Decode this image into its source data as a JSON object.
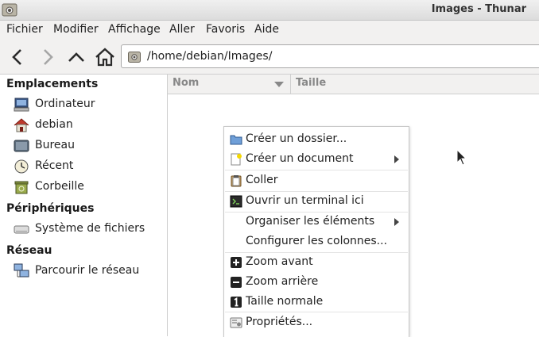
{
  "window": {
    "title": "Images - Thunar"
  },
  "menubar": {
    "items": [
      "Fichier",
      "Modifier",
      "Affichage",
      "Aller",
      "Favoris",
      "Aide"
    ]
  },
  "toolbar": {
    "icons": [
      "back-arrow-icon",
      "forward-arrow-icon",
      "parent-folder-icon",
      "home-icon"
    ],
    "location": "/home/debian/Images/"
  },
  "sidebar": {
    "sections": [
      {
        "title": "Emplacements",
        "items": [
          {
            "label": "Ordinateur",
            "icon": "computer-icon"
          },
          {
            "label": "debian",
            "icon": "home-folder-icon"
          },
          {
            "label": "Bureau",
            "icon": "desktop-icon"
          },
          {
            "label": "Récent",
            "icon": "clock-icon"
          },
          {
            "label": "Corbeille",
            "icon": "trash-icon"
          }
        ]
      },
      {
        "title": "Périphériques",
        "items": [
          {
            "label": "Système de fichiers",
            "icon": "drive-icon"
          }
        ]
      },
      {
        "title": "Réseau",
        "items": [
          {
            "label": "Parcourir le réseau",
            "icon": "network-icon"
          }
        ]
      }
    ]
  },
  "columns": [
    "Nom",
    "Taille"
  ],
  "context_menu": {
    "items": [
      {
        "label": "Créer un dossier...",
        "icon": "new-folder-icon"
      },
      {
        "label": "Créer un document",
        "icon": "new-document-icon",
        "submenu": true
      },
      {
        "label": "Coller",
        "icon": "paste-icon"
      },
      {
        "label": "Ouvrir un terminal ici",
        "icon": "terminal-icon"
      },
      {
        "label": "Organiser les éléments",
        "submenu": true
      },
      {
        "label": "Configurer les colonnes..."
      },
      {
        "label": "Zoom avant",
        "icon": "zoom-in-icon"
      },
      {
        "label": "Zoom arrière",
        "icon": "zoom-out-icon"
      },
      {
        "label": "Taille normale",
        "icon": "zoom-normal-icon"
      },
      {
        "label": "Propriétés...",
        "icon": "properties-icon"
      }
    ]
  }
}
